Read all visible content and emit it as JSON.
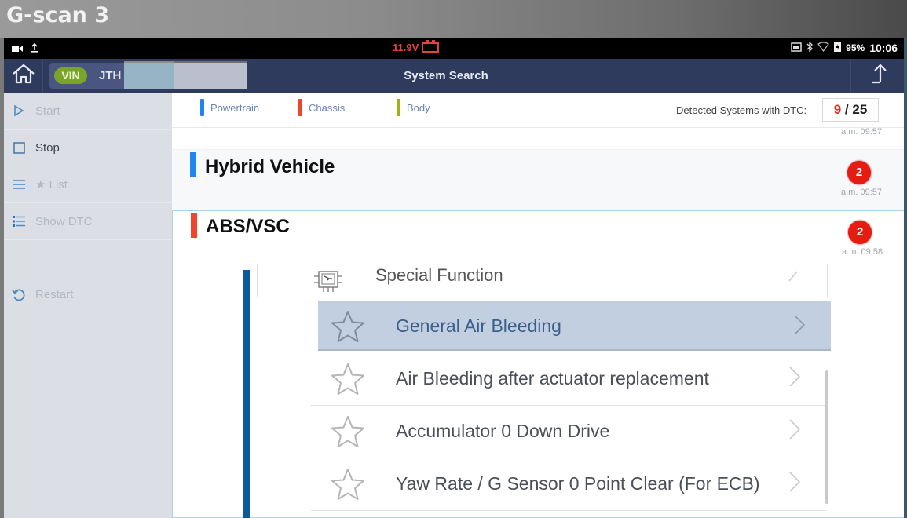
{
  "bezel": {
    "brand": "G-scan 3"
  },
  "status_bar": {
    "left_icons": [
      "video-camera-icon",
      "upload-icon"
    ],
    "voltage": "11.9V",
    "voltage_color": "#e0443a",
    "right_icons": [
      "cast-icon",
      "bluetooth-icon",
      "wifi-icon",
      "battery-charging-icon"
    ],
    "battery_percent": "95%",
    "time": "10:06"
  },
  "app_bar": {
    "home_icon": "home-icon",
    "vin_badge": "VIN",
    "vin_prefix": "JTH",
    "title": "System Search",
    "action_icon": "upload-arrow-icon"
  },
  "sidebar": {
    "items": [
      {
        "label": "Start",
        "icon": "play-icon",
        "enabled": false
      },
      {
        "label": "Stop",
        "icon": "stop-icon",
        "enabled": true
      },
      {
        "label": "★ List",
        "icon": "menu-icon",
        "enabled": false
      },
      {
        "label": "Show DTC",
        "icon": "list-icon",
        "enabled": false
      },
      {
        "label": "Restart",
        "icon": "restart-icon",
        "enabled": false
      }
    ]
  },
  "legend": {
    "items": [
      {
        "label": "Powertrain",
        "color": "#1f86f0"
      },
      {
        "label": "Chassis",
        "color": "#f0442c"
      },
      {
        "label": "Body",
        "color": "#a3b012"
      }
    ],
    "dtc_label": "Detected Systems with DTC:",
    "dtc_detected": "9",
    "dtc_separator": " / ",
    "dtc_total": "25",
    "prev_time": "a.m. 09:57"
  },
  "systems": [
    {
      "name": "Hybrid Vehicle",
      "color": "#1f86f0",
      "dtc_count": "2",
      "time": "a.m. 09:57"
    },
    {
      "name": "ABS/VSC",
      "color": "#f0442c",
      "dtc_count": "2",
      "time": "a.m. 09:58"
    }
  ],
  "functions": {
    "header": "Special Function",
    "header_icon": "ecu-chip-icon",
    "items": [
      {
        "label": "General Air Bleeding",
        "selected": true
      },
      {
        "label": "Air Bleeding after actuator replacement",
        "selected": false
      },
      {
        "label": "Accumulator 0 Down Drive",
        "selected": false
      },
      {
        "label": "Yaw Rate / G Sensor 0 Point Clear (For ECB)",
        "selected": false
      }
    ]
  }
}
